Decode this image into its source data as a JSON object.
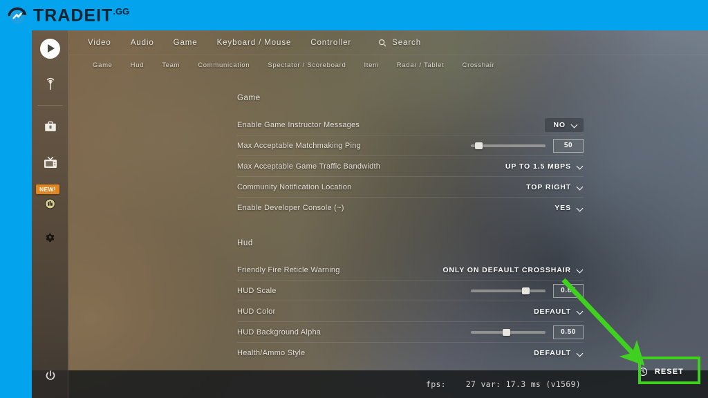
{
  "site": {
    "brand_name": "TRADEIT",
    "brand_tld": ".GG",
    "logo_icon": "refresh-circle-logo-icon"
  },
  "game_sidebar": {
    "items": [
      {
        "icon": "play-button-icon",
        "name": "play"
      },
      {
        "icon": "broadcast-antenna-icon",
        "name": "watch"
      },
      {
        "icon": "weapon-case-icon",
        "name": "inventory"
      },
      {
        "icon": "tv-icon",
        "name": "workshop"
      },
      {
        "icon": "medal-icon",
        "name": "premier",
        "badge": "NEW!"
      },
      {
        "icon": "gear-icon",
        "name": "settings"
      }
    ],
    "power": {
      "icon": "power-icon",
      "name": "quit"
    }
  },
  "topnav": {
    "tabs": [
      {
        "label": "Video"
      },
      {
        "label": "Audio"
      },
      {
        "label": "Game"
      },
      {
        "label": "Keyboard / Mouse"
      },
      {
        "label": "Controller"
      }
    ],
    "search": {
      "label": "Search",
      "icon": "search-icon"
    }
  },
  "subnav": {
    "tabs": [
      {
        "label": "Game"
      },
      {
        "label": "Hud"
      },
      {
        "label": "Team"
      },
      {
        "label": "Communication"
      },
      {
        "label": "Spectator / Scoreboard"
      },
      {
        "label": "Item"
      },
      {
        "label": "Radar / Tablet"
      },
      {
        "label": "Crosshair"
      }
    ]
  },
  "settings": {
    "sections": [
      {
        "title": "Game",
        "rows": [
          {
            "label": "Enable Game Instructor Messages",
            "type": "dropdown",
            "value": "NO",
            "highlighted": true
          },
          {
            "label": "Max Acceptable Matchmaking Ping",
            "type": "slider",
            "value": "50",
            "fill_percent": 10
          },
          {
            "label": "Max Acceptable Game Traffic Bandwidth",
            "type": "dropdown",
            "value": "UP TO 1.5 MBPS"
          },
          {
            "label": "Community Notification Location",
            "type": "dropdown",
            "value": "TOP RIGHT"
          },
          {
            "label": "Enable Developer Console (~)",
            "type": "dropdown",
            "value": "YES"
          }
        ]
      },
      {
        "title": "Hud",
        "rows": [
          {
            "label": "Friendly Fire Reticle Warning",
            "type": "dropdown",
            "value": "ONLY ON DEFAULT CROSSHAIR"
          },
          {
            "label": "HUD Scale",
            "type": "slider",
            "value": "0.85",
            "fill_percent": 74
          },
          {
            "label": "HUD Color",
            "type": "dropdown",
            "value": "DEFAULT"
          },
          {
            "label": "HUD Background Alpha",
            "type": "slider",
            "value": "0.50",
            "fill_percent": 48
          },
          {
            "label": "Health/Ammo Style",
            "type": "dropdown",
            "value": "DEFAULT"
          }
        ]
      }
    ]
  },
  "footer": {
    "fps_text": "fps:    27 var: 17.3 ms (v1569)",
    "reset": {
      "label": "RESET",
      "icon": "reset-clock-icon"
    }
  },
  "annotation": {
    "arrow_color": "#3fd020",
    "highlight_color": "#3fd020"
  },
  "colors": {
    "brand_blue": "#03a3ed",
    "brand_dark": "#10232e",
    "badge_orange": "#e08620",
    "accent_green": "#3fd020"
  }
}
